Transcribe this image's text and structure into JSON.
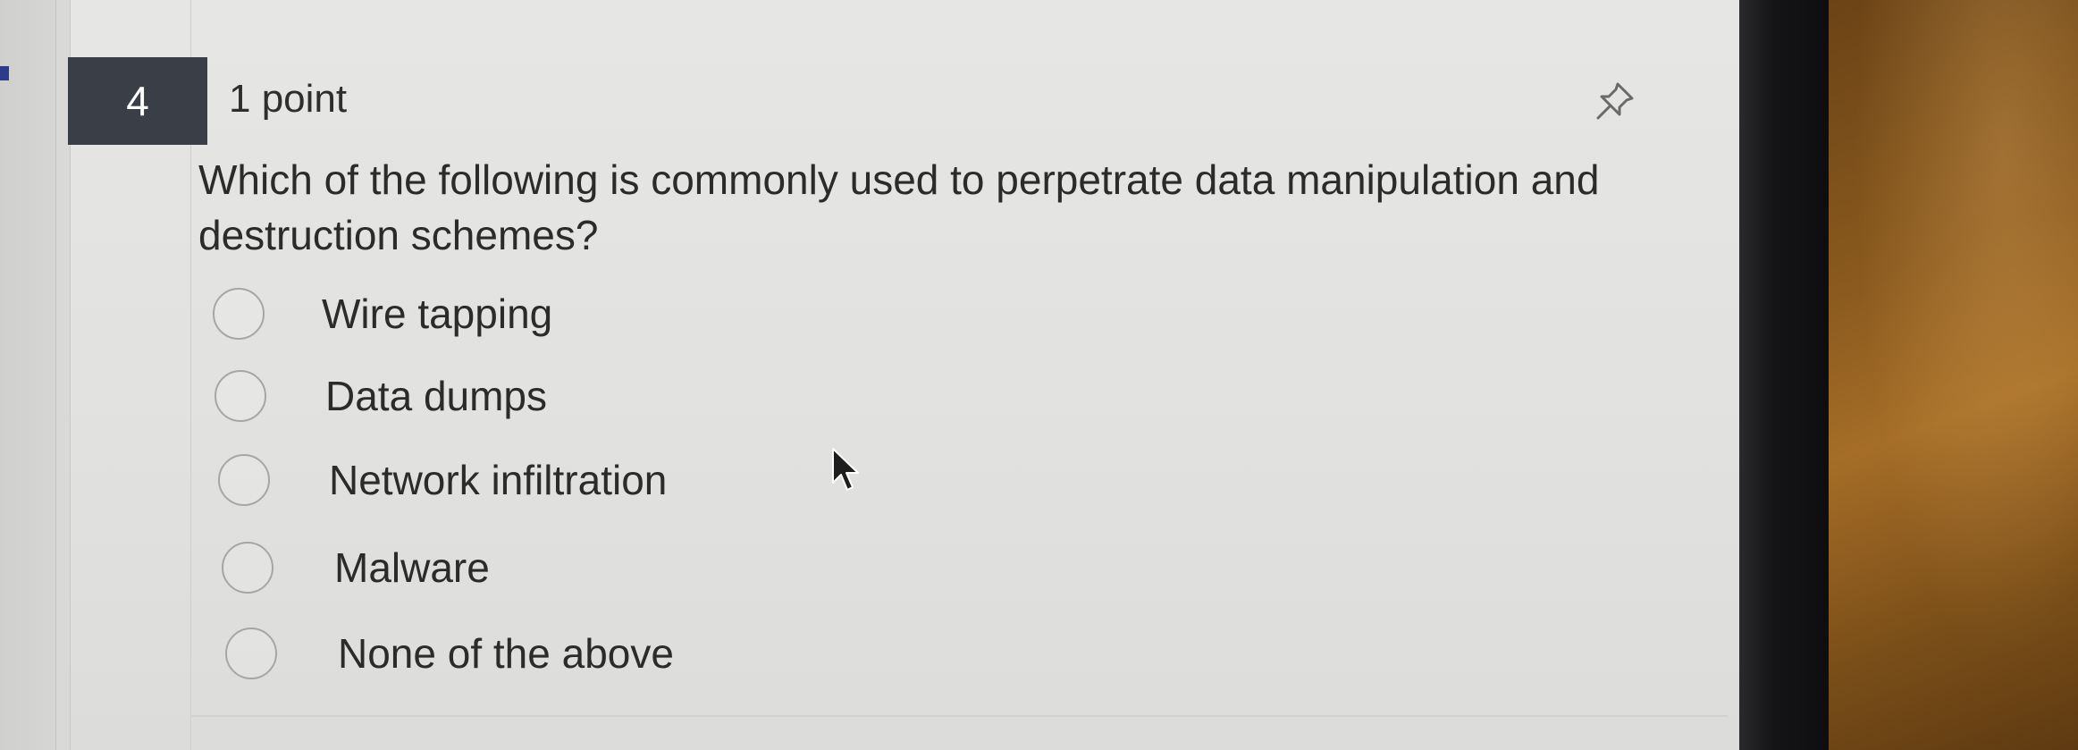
{
  "question": {
    "number": "4",
    "points": "1 point",
    "text": "Which of the following is commonly used to perpetrate data manipulation and destruction schemes?",
    "pin_icon": "pin-icon",
    "options": [
      {
        "label": "Wire tapping",
        "selected": false
      },
      {
        "label": "Data dumps",
        "selected": false
      },
      {
        "label": "Network infiltration",
        "selected": false
      },
      {
        "label": "Malware",
        "selected": false
      },
      {
        "label": "None of the above",
        "selected": false
      }
    ]
  },
  "colors": {
    "badge_bg": "#3a3f47",
    "text": "#2b2b2b",
    "radio_border": "#a6a6a6"
  }
}
